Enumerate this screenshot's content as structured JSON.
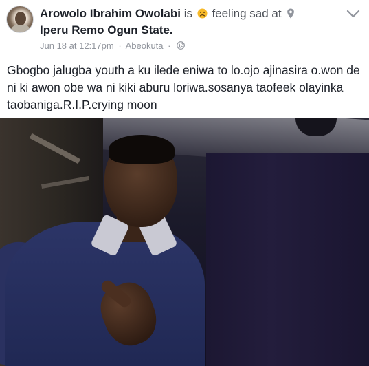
{
  "post": {
    "author": "Arowolo Ibrahim Owolabi",
    "is_word": "is",
    "feeling_text": "feeling sad at",
    "location": "Iperu Remo Ogun State.",
    "time": "Jun 18 at 12:17pm",
    "separator": "·",
    "place": "Abeokuta",
    "separator2": "·",
    "body": "Gbogbo jalugba youth a ku ilede eniwa to lo.ojo ajinasira o.won de ni ki awon obe wa ni kiki aburu loriwa.sosanya taofeek olayinka taobaniga.R.I.P.crying moon",
    "icons": {
      "feeling": "sad-face-emoji-icon",
      "location": "map-pin-icon",
      "privacy": "globe-icon",
      "menu": "chevron-down-icon"
    },
    "colors": {
      "text": "#1d2129",
      "meta": "#90949c",
      "emoji": "#f7b928"
    }
  }
}
